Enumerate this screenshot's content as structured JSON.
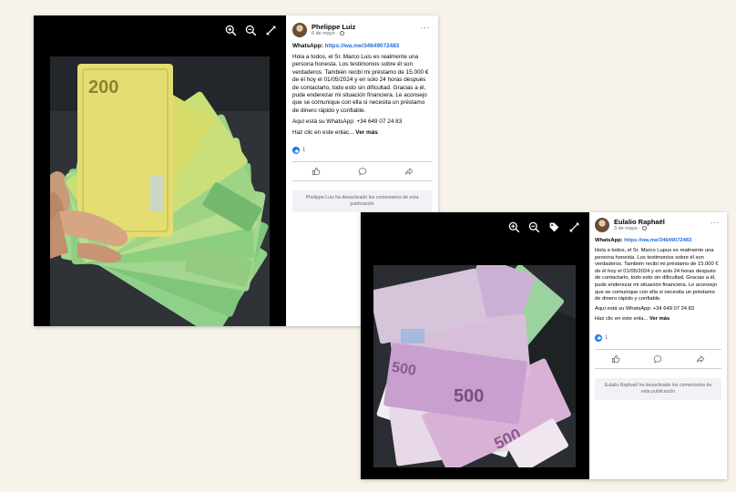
{
  "post1": {
    "author": "Phelippe Luiz",
    "date": "6 de mayo ·",
    "whatsapp_label": "WhatsApp:",
    "whatsapp_link": "https://wa.me/34649072483",
    "body_text": "Hola a todos, el Sr. Marco Luis es realmente una persona honesta. Los testimonios sobre él son verdaderos. También recibí mi préstamo de 15.000 € de él hoy el 01/05/2024 y en solo 24 horas después de contactarlo, todo esto sin dificultad. Gracias a él, pude enderezar mi situación financiera. Le aconsejo que se comunique con ella si necesita un préstamo de dinero rápido y confiable.",
    "phone_line": "Aquí está su WhatsApp: +34 649 07 24 83",
    "click_text": "Haz clic en este enlac...",
    "see_more": "Ver más",
    "reaction_count": "1",
    "comments_off_notice": "Phelippe Luiz ha desactivado los comentarios de esta publicación"
  },
  "post2": {
    "author": "Eulalio Raphaël",
    "date": "3 de mayo ·",
    "whatsapp_label": "WhatsApp:",
    "whatsapp_link": "https://wa.me/34649072483",
    "body_text": "Hola a todos, el Sr. Marco Lupus es realmente una persona honesta. Los testimonios sobre él son verdaderos. También recibí mi préstamo de 15.000 € de él hoy el 01/05/2024 y en solo 24 horas después de contactarlo, todo esto sin dificultad. Gracias a él, pude enderezar mi situación financiera. Le aconsejo que se comunique con ella si necesita un préstamo de dinero rápido y confiable.",
    "phone_line": "Aquí está su WhatsApp: +34 649 07 24 83",
    "click_text": "Haz clic en este enla...",
    "see_more": "Ver más",
    "reaction_count": "1",
    "comments_off_notice": "Eulalio Raphaël ha desactivado los comentarios de esta publicación"
  },
  "colors": {
    "link": "#216fdb",
    "like": "#1877f2",
    "page_bg": "#f7f3ea",
    "viewer_bg": "#000000"
  },
  "icons": [
    "zoom-in-icon",
    "zoom-out-icon",
    "tag-icon",
    "fullscreen-icon",
    "more-icon",
    "globe-icon",
    "like-icon",
    "comment-icon",
    "share-icon"
  ]
}
